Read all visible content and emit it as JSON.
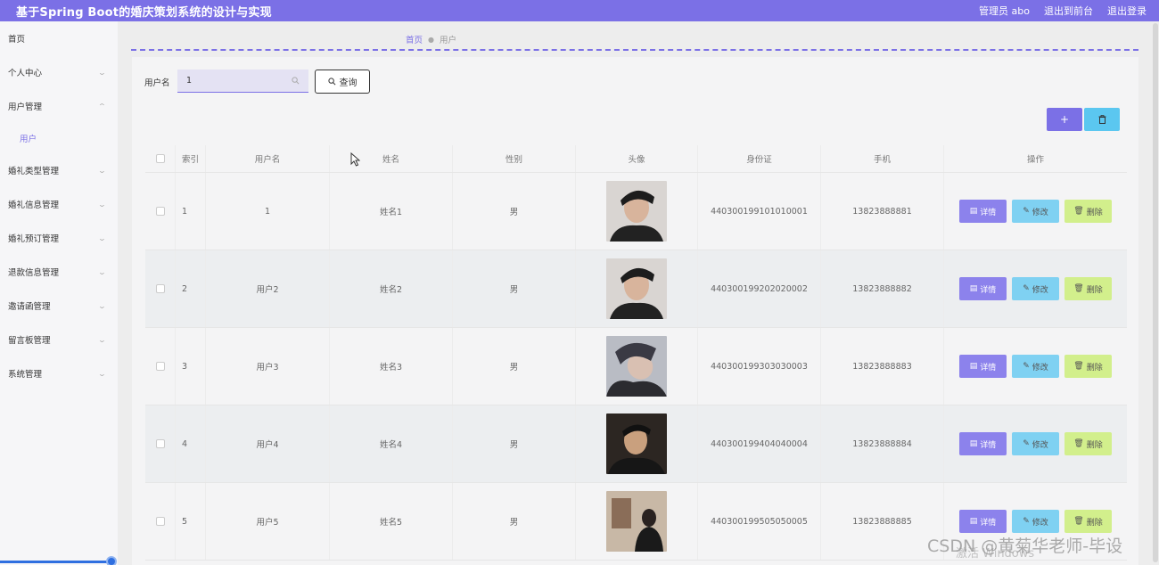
{
  "header": {
    "title": "基于Spring Boot的婚庆策划系统的设计与实现",
    "admin_label": "管理员 abo",
    "frontend_link": "退出到前台",
    "logout_link": "退出登录",
    "accent_color": "#7b70e6"
  },
  "sidebar": {
    "items": [
      {
        "label": "首页",
        "chevron": ""
      },
      {
        "label": "个人中心",
        "chevron": "chevron-down"
      },
      {
        "label": "用户管理",
        "chevron": "chevron-up"
      },
      {
        "label": "用户",
        "chevron": "",
        "active": true
      },
      {
        "label": "婚礼类型管理",
        "chevron": "chevron-down"
      },
      {
        "label": "婚礼信息管理",
        "chevron": "chevron-down"
      },
      {
        "label": "婚礼预订管理",
        "chevron": "chevron-down"
      },
      {
        "label": "退款信息管理",
        "chevron": "chevron-down"
      },
      {
        "label": "邀请函管理",
        "chevron": "chevron-down"
      },
      {
        "label": "留言板管理",
        "chevron": "chevron-down"
      },
      {
        "label": "系统管理",
        "chevron": "chevron-down"
      }
    ]
  },
  "breadcrumb": {
    "home": "首页",
    "current": "用户"
  },
  "search": {
    "label": "用户名",
    "value": "1",
    "button_label": "查询"
  },
  "toolbar": {
    "add_symbol": "+",
    "delete_icon": "trash-icon"
  },
  "table": {
    "headers": [
      "索引",
      "用户名",
      "姓名",
      "性别",
      "头像",
      "身份证",
      "手机",
      "操作"
    ],
    "rows": [
      {
        "index": "1",
        "username": "1",
        "name": "姓名1",
        "gender": "男",
        "id_card": "440300199101010001",
        "phone": "13823888881"
      },
      {
        "index": "2",
        "username": "用户2",
        "name": "姓名2",
        "gender": "男",
        "id_card": "440300199202020002",
        "phone": "13823888882"
      },
      {
        "index": "3",
        "username": "用户3",
        "name": "姓名3",
        "gender": "男",
        "id_card": "440300199303030003",
        "phone": "13823888883"
      },
      {
        "index": "4",
        "username": "用户4",
        "name": "姓名4",
        "gender": "男",
        "id_card": "440300199404040004",
        "phone": "13823888884"
      },
      {
        "index": "5",
        "username": "用户5",
        "name": "姓名5",
        "gender": "男",
        "id_card": "440300199505050005",
        "phone": "13823888885"
      }
    ],
    "actions": {
      "detail": "详情",
      "edit": "修改",
      "delete": "删除"
    }
  },
  "overlay": {
    "watermark": "CSDN @黄菊华老师-毕设",
    "activate": "激活 Windows"
  }
}
